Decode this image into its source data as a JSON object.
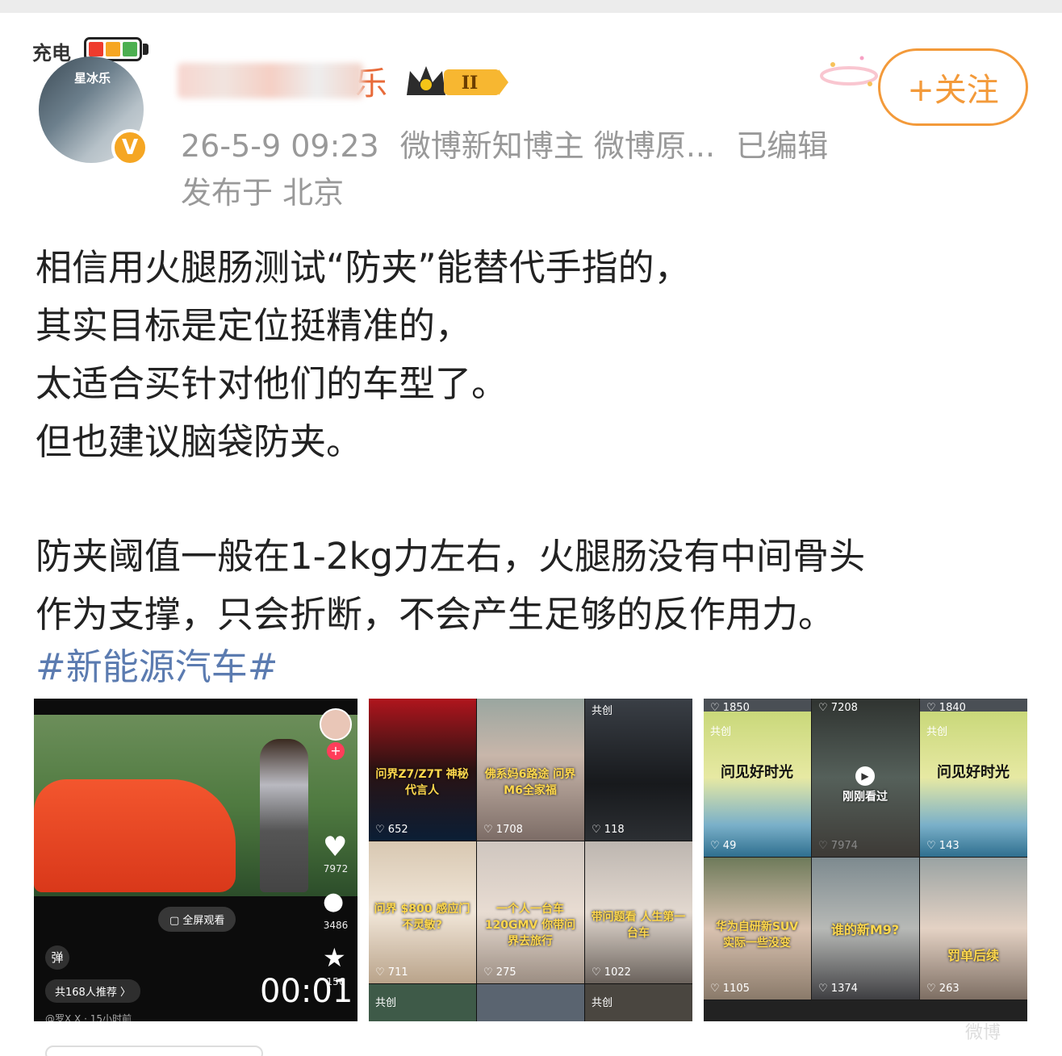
{
  "header": {
    "charge_label": "充电",
    "avatar_text": "星冰乐",
    "verified_mark": "V",
    "username_suffix": "乐",
    "level_badge": "II",
    "follow_label": "+关注"
  },
  "meta": {
    "datetime": "26-5-9 09:23",
    "source": "微博新知博主 微博原...",
    "edited": "已编辑",
    "location": "发布于 北京"
  },
  "post": {
    "lines": [
      "相信用火腿肠测试“防夹”能替代手指的，",
      "其实目标是定位挺精准的，",
      "太适合买针对他们的车型了。",
      "但也建议脑袋防夹。",
      "防夹阈值一般在1-2kg力左右，火腿肠没有中间骨头",
      "作为支撑，只会折断，不会产生足够的反作用力。"
    ],
    "hashtag": "#新能源汽车#"
  },
  "image1": {
    "fullscreen": "全屏观看",
    "likes": "7972",
    "comments": "3486",
    "stars": "156",
    "danmu": "弹",
    "recommend": "共168人推荐 〉",
    "time": "00:01",
    "footer": "@罗X X · 15小时前"
  },
  "image2": {
    "tiles": [
      {
        "caption": "问界Z7/Z7T 神秘代言人",
        "count": "652"
      },
      {
        "caption": "佛系妈6路途 问界M6全家福",
        "count": "1708"
      },
      {
        "caption": "",
        "count": "118",
        "tag": "共创"
      },
      {
        "caption": "问界 $800 感应门不灵敏?",
        "count": "711"
      },
      {
        "caption": "一个人一台车 120GMV 你带问界去旅行",
        "count": "275"
      },
      {
        "caption": "带问题看 人生第一台车",
        "count": "1022"
      }
    ],
    "bottom_tag_1": "共创",
    "bottom_tag_2": "共创"
  },
  "image3": {
    "tiles": [
      {
        "top": "1850",
        "caption": "问见好时光",
        "count": "49",
        "tag": "共创"
      },
      {
        "top": "7208",
        "caption": "刚刚看过",
        "count": "7974"
      },
      {
        "top": "1840",
        "caption": "问见好时光",
        "count": "143",
        "tag": "共创"
      },
      {
        "caption": "华为自研新SUV 实际一些没变",
        "count": "1105"
      },
      {
        "caption": "谁的新M9?",
        "count": "1374"
      },
      {
        "caption": "罚单后续",
        "count": "263"
      }
    ]
  },
  "watermark": "微博"
}
